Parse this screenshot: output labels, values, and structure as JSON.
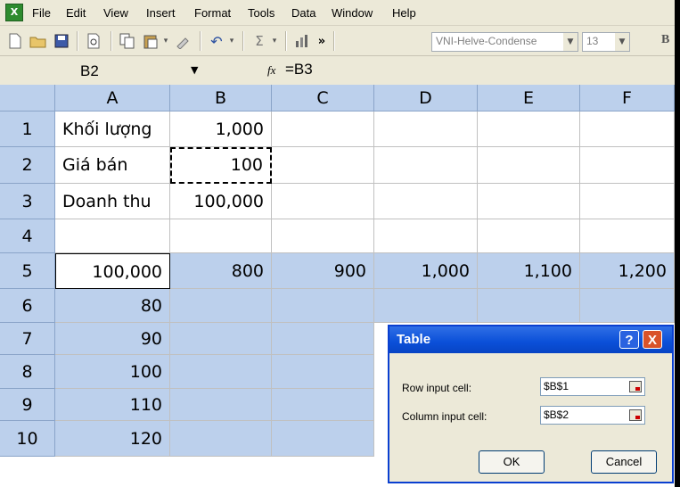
{
  "menu": {
    "items": [
      "File",
      "Edit",
      "View",
      "Insert",
      "Format",
      "Tools",
      "Data",
      "Window",
      "Help"
    ]
  },
  "toolbar": {
    "font_name": "VNI-Helve-Condense",
    "font_size": "13",
    "bold_label": "B",
    "autosum_label": "Σ",
    "overflow_label": "»"
  },
  "formula_bar": {
    "name_box": "B2",
    "fx_label": "fx",
    "formula": "=B3"
  },
  "sheet": {
    "columns": [
      "A",
      "B",
      "C",
      "D",
      "E",
      "F"
    ],
    "rows": [
      "1",
      "2",
      "3",
      "4",
      "5",
      "6",
      "7",
      "8",
      "9",
      "10"
    ],
    "cells": {
      "A1": "Khối lượng",
      "B1": "1,000",
      "A2": "Giá bán",
      "B2": "100",
      "A3": "Doanh thu",
      "B3": "100,000",
      "A5": "100,000",
      "B5": "800",
      "C5": "900",
      "D5": "1,000",
      "E5": "1,100",
      "F5": "1,200",
      "A6": "80",
      "A7": "90",
      "A8": "100",
      "A9": "110",
      "A10": "120"
    }
  },
  "dialog": {
    "title": "Table",
    "help_label": "?",
    "close_label": "X",
    "row_label": "Row input cell:",
    "row_value": "$B$1",
    "col_label": "Column input cell:",
    "col_value": "$B$2",
    "ok_label": "OK",
    "cancel_label": "Cancel"
  }
}
